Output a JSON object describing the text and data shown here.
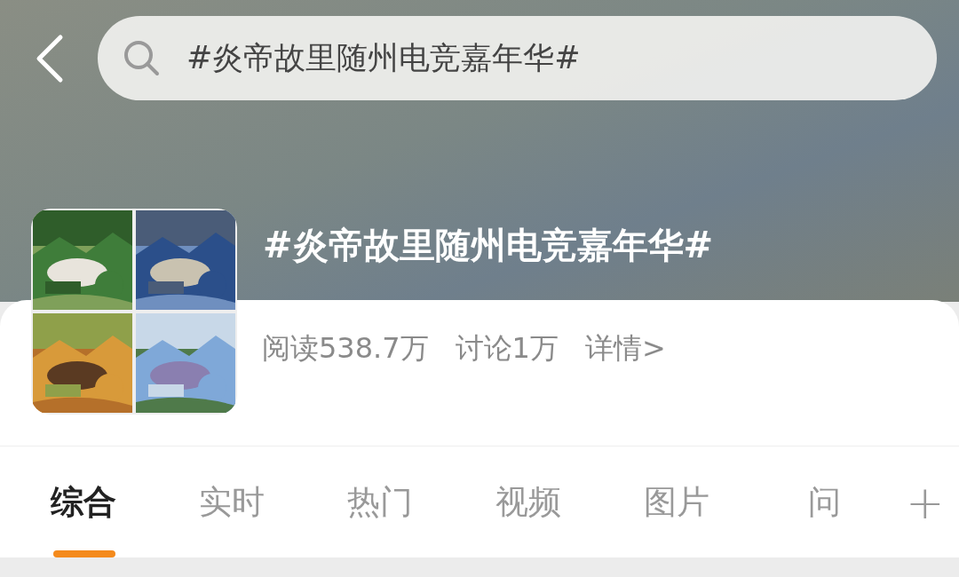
{
  "search": {
    "value": "#炎帝故里随州电竞嘉年华#"
  },
  "topic": {
    "title": "#炎帝故里随州电竞嘉年华#",
    "reads": "阅读538.7万",
    "discussions": "讨论1万",
    "details_link": "详情>"
  },
  "tabs": [
    {
      "label": "综合",
      "selected": true
    },
    {
      "label": "实时",
      "selected": false
    },
    {
      "label": "热门",
      "selected": false
    },
    {
      "label": "视频",
      "selected": false
    },
    {
      "label": "图片",
      "selected": false
    },
    {
      "label": "问",
      "selected": false
    }
  ],
  "add_tab": {
    "label": "+"
  }
}
